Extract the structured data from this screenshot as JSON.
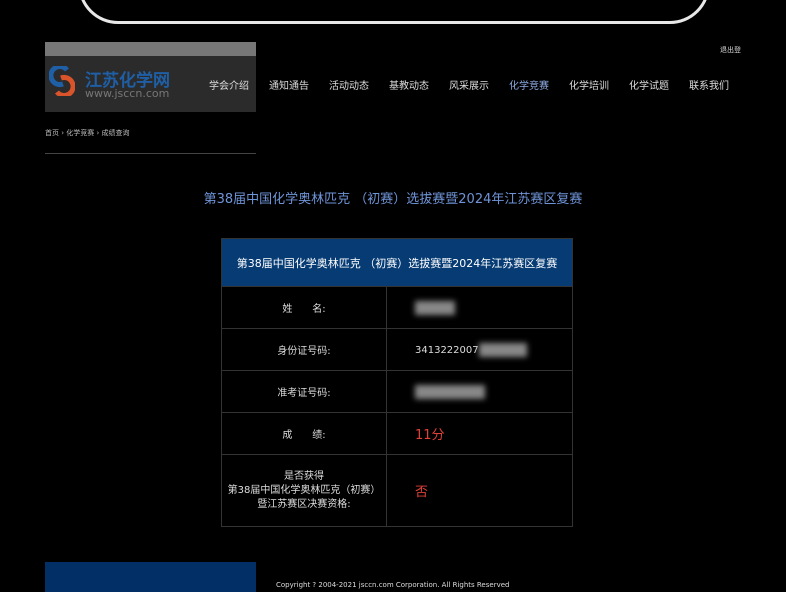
{
  "header": {
    "logo_text": "江苏化学网",
    "logo_url": "www.jsccn.com",
    "logout": "退出登"
  },
  "nav": [
    "学会介绍",
    "通知通告",
    "活动动态",
    "基教动态",
    "风采展示",
    "化学竞赛",
    "化学培训",
    "化学试题",
    "联系我们"
  ],
  "nav_active": 5,
  "breadcrumb": "首页 › 化学竞赛 › 成绩查询",
  "page_title": "第38届中国化学奥林匹克 （初赛）选拔赛暨2024年江苏赛区复赛",
  "table": {
    "header": "第38届中国化学奥林匹克 （初赛）选拔赛暨2024年江苏赛区复赛",
    "rows": [
      {
        "label": "姓　　名:",
        "value": ""
      },
      {
        "label": "身份证号码:",
        "value": "3413222007"
      },
      {
        "label": "准考证号码:",
        "value": ""
      },
      {
        "label": "成　　绩:",
        "value": "11分"
      },
      {
        "label": "是否获得\n第38届中国化学奥林匹克（初赛）\n暨江苏赛区决赛资格:",
        "value": "否"
      }
    ]
  },
  "footer": {
    "copyright": "Copyright ? 2004-2021 jsccn.com Corporation. All Rights Reserved"
  }
}
